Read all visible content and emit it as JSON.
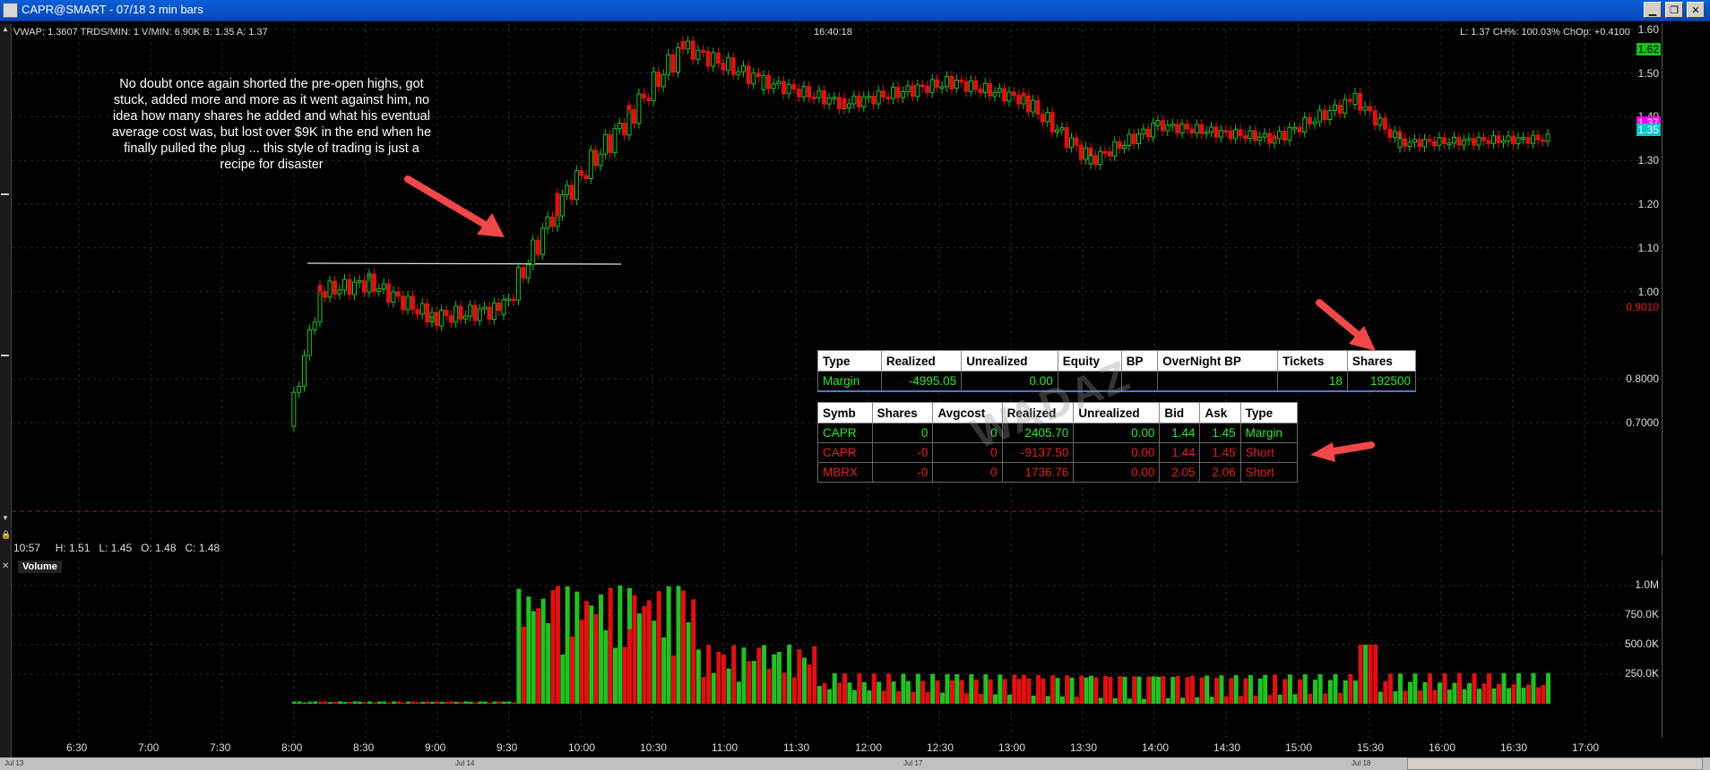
{
  "window": {
    "title": "CAPR@SMART - 07/18 3 min bars"
  },
  "price_header": {
    "left": "VWAP: 1.3607 TRDS/MIN: 1 V/MIN: 6.90K B: 1.35 A: 1.37",
    "center": "16:40:18",
    "right": "L: 1.37 CH%: 100.03% ChOp: +0.4100"
  },
  "ohlc_readout": {
    "time": "10:57",
    "high": "H: 1.51",
    "low": "L: 1.45",
    "open": "O: 1.48",
    "close": "C: 1.48"
  },
  "annotation": "No doubt once again shorted the pre-open highs, got stuck, added more and more as it went against him, no idea how many shares he added and what his eventual average cost was, but lost over $9K in the end when he finally pulled the plug ... this style of trading is just a recipe for disaster",
  "price_axis": {
    "ticks": [
      "1.60",
      "1.50",
      "1.40",
      "1.30",
      "1.20",
      "1.10",
      "1.00",
      "0.8000",
      "0.7000"
    ],
    "tags": [
      {
        "label": "1.62",
        "bg": "#16c016",
        "fg": "#000"
      },
      {
        "label": "1.37",
        "bg": "#ff00ff",
        "fg": "#fff"
      },
      {
        "label": "1.35",
        "bg": "#00c8c8",
        "fg": "#fff"
      },
      {
        "label": "0.9010",
        "bg": "#000",
        "fg": "#e81c1c"
      }
    ]
  },
  "volume_pane": {
    "label": "Volume",
    "ticks": [
      "1.0M",
      "750.0K",
      "500.0K",
      "250.0K"
    ]
  },
  "time_axis": [
    "6:30",
    "7:00",
    "7:30",
    "8:00",
    "8:30",
    "9:00",
    "9:30",
    "10:00",
    "10:30",
    "11:00",
    "11:30",
    "12:00",
    "12:30",
    "13:00",
    "13:30",
    "14:00",
    "14:30",
    "15:00",
    "15:30",
    "16:00",
    "16:30",
    "17:00"
  ],
  "date_strip": [
    "Jul 13",
    "Jul 14",
    "Jul 17",
    "Jul 18"
  ],
  "account_table": {
    "headers": [
      "Type",
      "Realized",
      "Unrealized",
      "Equity",
      "BP",
      "OverNight BP",
      "Tickets",
      "Shares"
    ],
    "row": [
      "Margin",
      "-4995.05",
      "0.00",
      "",
      "",
      "",
      "18",
      "192500"
    ]
  },
  "positions_table": {
    "headers": [
      "Symb",
      "Shares",
      "Avgcost",
      "Realized",
      "Unrealized",
      "Bid",
      "Ask",
      "Type"
    ],
    "rows": [
      {
        "cells": [
          "CAPR",
          "0",
          "0",
          "2405.70",
          "0.00",
          "1.44",
          "1.45",
          "Margin"
        ],
        "color": "green"
      },
      {
        "cells": [
          "CAPR",
          "-0",
          "0",
          "-9137.50",
          "0.00",
          "1.44",
          "1.45",
          "Short"
        ],
        "color": "red"
      },
      {
        "cells": [
          "MBRX",
          "-0",
          "0",
          "1736.76",
          "0.00",
          "2.05",
          "2.06",
          "Short"
        ],
        "color": "red"
      }
    ]
  },
  "watermark": "WADAZ",
  "colors": {
    "up": "#22c022",
    "down": "#e01010",
    "neutral": "#ffff00",
    "accent_line": "#ffffff",
    "arrow": "#f04848"
  }
}
